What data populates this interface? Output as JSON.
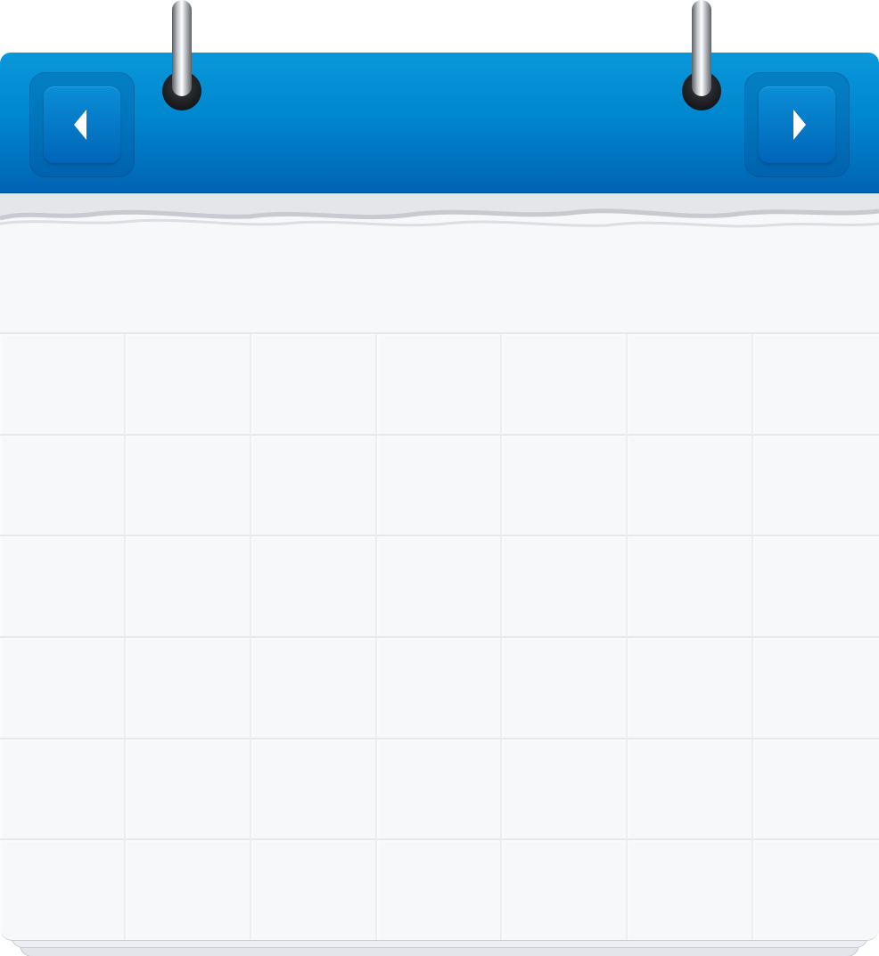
{
  "header": {
    "title": "",
    "prev_icon": "chevron-left-icon",
    "next_icon": "chevron-right-icon"
  },
  "colors": {
    "header_top": "#0a98da",
    "header_bottom": "#0064b3",
    "sheet_background": "#f7f8fa",
    "grid_line": "#e6e8ec"
  },
  "grid": {
    "rows": 6,
    "columns": 7,
    "days": [
      "",
      "",
      "",
      "",
      "",
      "",
      "",
      "",
      "",
      "",
      "",
      "",
      "",
      "",
      "",
      "",
      "",
      "",
      "",
      "",
      "",
      "",
      "",
      "",
      "",
      "",
      "",
      "",
      "",
      "",
      "",
      "",
      "",
      "",
      "",
      "",
      "",
      "",
      "",
      "",
      "",
      ""
    ]
  }
}
